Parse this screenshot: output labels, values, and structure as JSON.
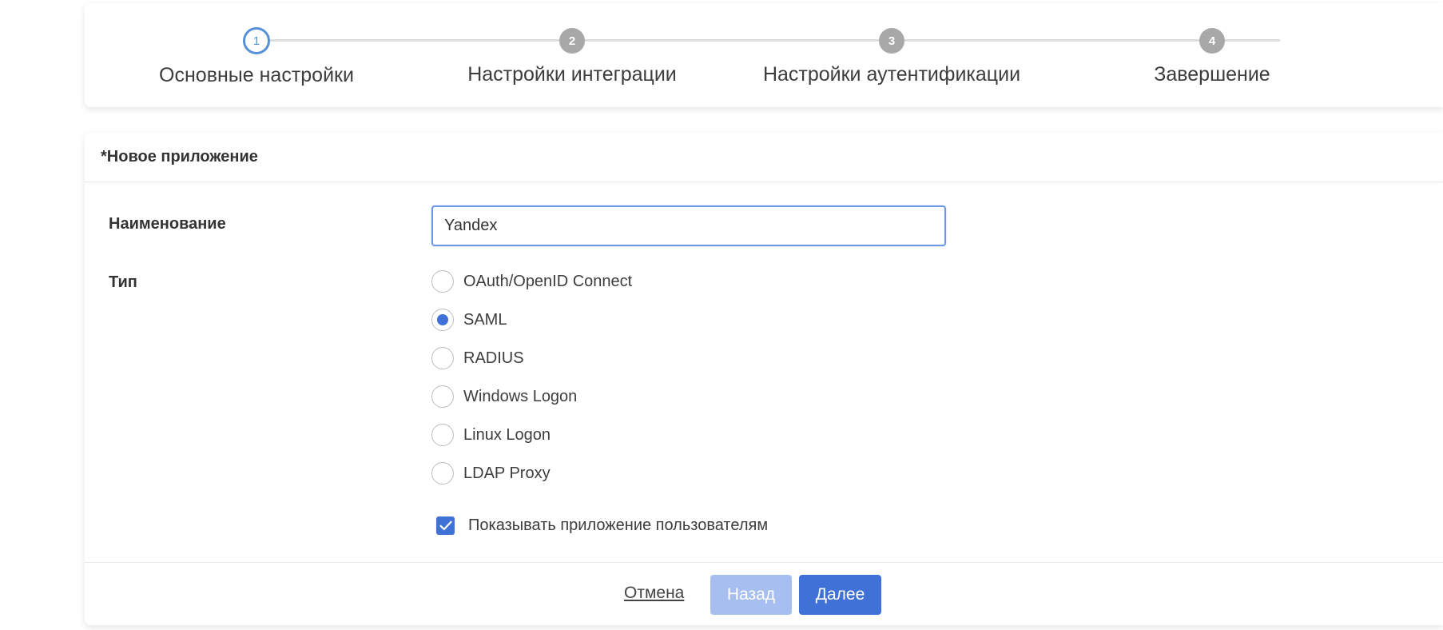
{
  "stepper": {
    "steps": [
      {
        "number": "1",
        "label": "Основные настройки",
        "state": "active"
      },
      {
        "number": "2",
        "label": "Настройки интеграции",
        "state": "inactive"
      },
      {
        "number": "3",
        "label": "Настройки аутентификации",
        "state": "inactive"
      },
      {
        "number": "4",
        "label": "Завершение",
        "state": "inactive"
      }
    ]
  },
  "form": {
    "title": "*Новое приложение",
    "name_label": "Наименование",
    "name_value": "Yandex",
    "type_label": "Тип",
    "type_options": [
      {
        "label": "OAuth/OpenID Connect",
        "selected": false
      },
      {
        "label": "SAML",
        "selected": true
      },
      {
        "label": "RADIUS",
        "selected": false
      },
      {
        "label": "Windows Logon",
        "selected": false
      },
      {
        "label": "Linux Logon",
        "selected": false
      },
      {
        "label": "LDAP Proxy",
        "selected": false
      }
    ],
    "show_to_users_label": "Показывать приложение пользователям",
    "show_to_users_checked": true
  },
  "footer": {
    "cancel_label": "Отмена",
    "back_label": "Назад",
    "next_label": "Далее"
  },
  "colors": {
    "accent": "#3f71d6",
    "accent_disabled": "#a6bff0",
    "step_active": "#5590d8",
    "step_inactive": "#a8a8a8"
  }
}
